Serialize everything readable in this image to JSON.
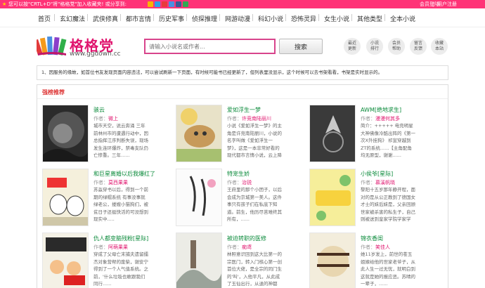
{
  "topbar": {
    "tip": "您可以按\"CRTL+D\"将\"格格党\"加入收藏夹! 或分享到:",
    "login": "会员登陆",
    "separator": "|",
    "register": "用户注册",
    "share_colors": [
      "#f7b500",
      "#2e9fe8",
      "#e83b3b",
      "#4a90e2",
      "#3b5998",
      "#32a852"
    ]
  },
  "nav": [
    "首页",
    "玄幻魔法",
    "武侠修真",
    "都市言情",
    "历史军事",
    "侦探推理",
    "网游动漫",
    "科幻小说",
    "恐怖灵异",
    "女生小说",
    "其他类型",
    "全本小说"
  ],
  "header": {
    "logo_title": "格格党",
    "logo_url": "www.ggdown.cc",
    "search_placeholder": "请输入小说名或作者...",
    "search_button": "搜索",
    "quick_links": [
      {
        "line1": "最近",
        "line2": "更新"
      },
      {
        "line1": "小说",
        "line2": "排行"
      },
      {
        "line1": "会员",
        "line2": "帮助"
      },
      {
        "line1": "留言",
        "line2": "反馈"
      },
      {
        "line1": "收藏",
        "line2": "本站"
      }
    ]
  },
  "notice": "1、因服务的缘故，如首位书友发现页面内容违法，可以尝试刷新一下页面，有时候可能书已经更新了，但列表里没显示，这个时候可以去书架看看，书架是实时显示的。",
  "panel": {
    "title": "强榜推荐",
    "author_prefix": "作者：",
    "books": [
      {
        "title": "骇云",
        "author": "微上",
        "desc": "城市天空，说云奔涌 三年前林州市的遭遇行动中，因总指挥江序判断失误，现场发生连环爆炸，禁毒支队仍亡惨重。三年......"
      },
      {
        "title": "爱如浮生一梦",
        "author": "许竞南陆丽川",
        "desc": "小说《爱如浮生一梦》的主角是许竞南陆丽川，小说的名字叫做《爱如浮生一梦》，这是一本非常好看的现代都市言情小说，云上降书是本书的作者，爱如......"
      },
      {
        "title": "AWM[绝地求生]",
        "author": "漫漫何其多",
        "desc": "简介：+++++ 电竞明星大神佛像冷酷出阵的《第一次X外挂狗》 祁宣穿越到ZT的系统......【主角配角均无原型，谢谢......"
      },
      {
        "title": "和巨星离婚以后我爆红了",
        "author": "莫西果果",
        "desc": "苏淼穿书以后，得到一个前期的绿帽系统 有事没事就绿老公，搂嫂小猫狗们，被贫日子还挺快活的可没想到现实中....."
      },
      {
        "title": "特宠生娇",
        "author": "治锐",
        "desc": "王府里的那个小团子，以后会成为京城第一美人。这件事只有孩子们在私底下知道。前生，他历尽苦难终其所有，......"
      },
      {
        "title": "小侯爷[星际]",
        "author": "慕溪帆晓",
        "desc": "黎阳十五岁那年静开程，面对的是从公正教到了德国女才士的妹后妹是，父亲回顾世家被杀害的私生子，自己则被送到皇家学院学家学子......"
      },
      {
        "title": "仇人都变脑残粉[星际]",
        "author": "阿萌果果",
        "desc": "穿成了父母亡末捕夫遗留擂杰对象营帮的废柴，谢安宁得到了一个人气值系统。之前，'什么垃圾也敢跟我们同行......"
      },
      {
        "title": "被迫转职的医修",
        "author": "痴鸢",
        "desc": "林照意识回到这大比第一的宗医门，转入门核心第一创首位大佬，是全宗的同门生的'叫'，入他平凡，从此成了玉仙出行，从退的神都宗......"
      },
      {
        "title": "锦衣香闺",
        "author": "笑佳人",
        "desc": "她11岁发上，前世的苍玉姐嫁给他的世家老爷子，从此人生一过无忧，就明白到这就是她的报应恶。苏晴的一辈子，......"
      }
    ]
  }
}
